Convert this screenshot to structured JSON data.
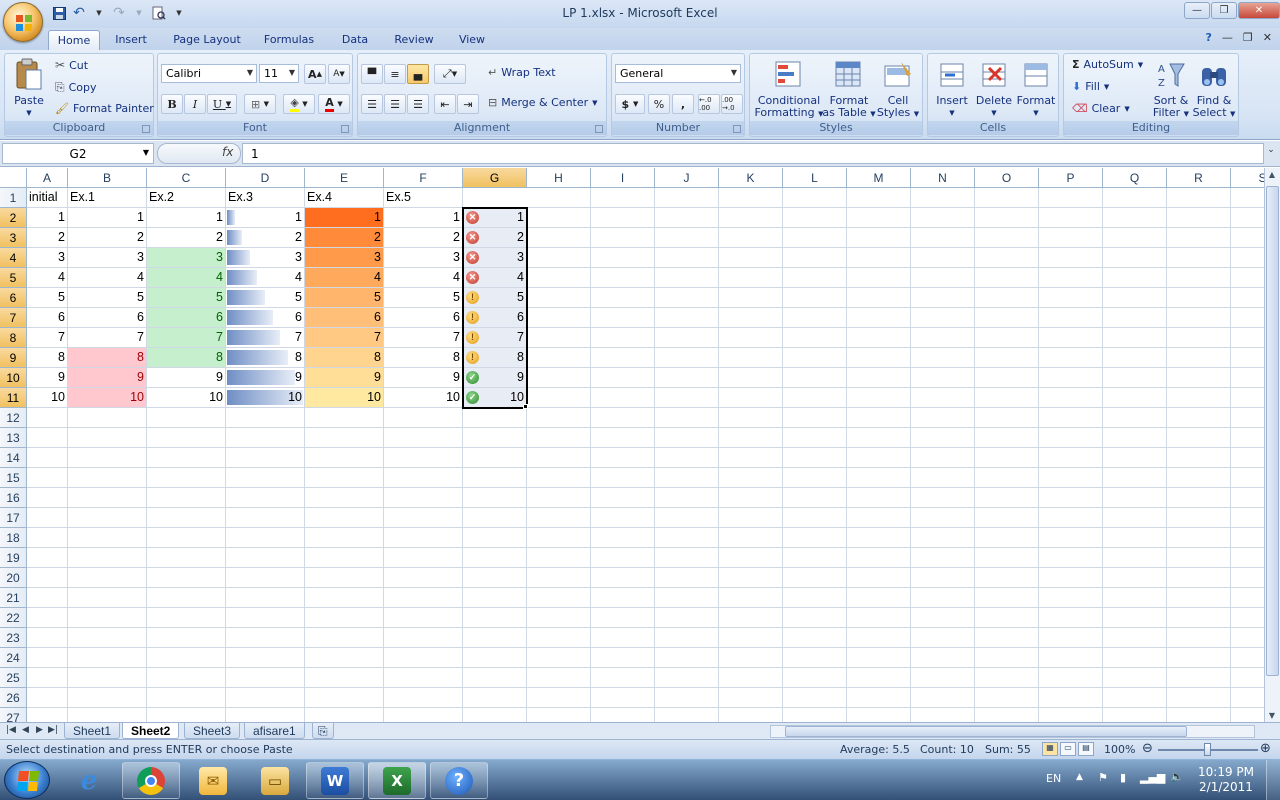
{
  "window": {
    "title": "LP 1.xlsx - Microsoft Excel"
  },
  "quick_access": {
    "icons": [
      "save-icon",
      "undo-icon",
      "redo-icon",
      "print-preview-icon",
      "customize-icon"
    ]
  },
  "ribbon_tabs": [
    "Home",
    "Insert",
    "Page Layout",
    "Formulas",
    "Data",
    "Review",
    "View"
  ],
  "active_tab": "Home",
  "clipboard": {
    "paste": "Paste",
    "cut": "Cut",
    "copy": "Copy",
    "format_painter": "Format Painter",
    "label": "Clipboard"
  },
  "font": {
    "family": "Calibri",
    "size": "11",
    "label": "Font",
    "bold": "B",
    "italic": "I",
    "underline": "U",
    "grow": "A",
    "shrink": "A",
    "color_letter": "A"
  },
  "alignment": {
    "wrap": "Wrap Text",
    "merge": "Merge & Center",
    "label": "Alignment"
  },
  "number": {
    "format": "General",
    "currency": "$",
    "percent": "%",
    "comma": ",",
    "inc_decimal": "←.0 .00",
    "dec_decimal": ".00 →.0",
    "label": "Number"
  },
  "styles": {
    "conditional_1": "Conditional",
    "conditional_2": "Formatting",
    "format_table_1": "Format",
    "format_table_2": "as Table",
    "cell_styles_1": "Cell",
    "cell_styles_2": "Styles",
    "label": "Styles"
  },
  "cells_group": {
    "insert": "Insert",
    "delete": "Delete",
    "format": "Format",
    "label": "Cells"
  },
  "editing": {
    "autosum": "AutoSum",
    "fill": "Fill",
    "clear": "Clear",
    "sort_1": "Sort &",
    "sort_2": "Filter",
    "find_1": "Find &",
    "find_2": "Select",
    "label": "Editing"
  },
  "formula_bar": {
    "name_box": "G2",
    "fx": "fx",
    "content": "1"
  },
  "columns": [
    "A",
    "B",
    "C",
    "D",
    "E",
    "F",
    "G",
    "H",
    "I",
    "J",
    "K",
    "L",
    "M",
    "N",
    "O",
    "P",
    "Q",
    "R",
    "S"
  ],
  "selected_column": "G",
  "row_numbers": [
    "1",
    "2",
    "3",
    "4",
    "5",
    "6",
    "7",
    "8",
    "9",
    "10",
    "11",
    "12",
    "13",
    "14",
    "15",
    "16",
    "17",
    "18",
    "19",
    "20",
    "21",
    "22",
    "23",
    "24",
    "25",
    "26",
    "27"
  ],
  "headers": {
    "A": "initial",
    "B": "Ex.1",
    "C": "Ex.2",
    "D": "Ex.3",
    "E": "Ex.4",
    "F": "Ex.5"
  },
  "values": [
    "1",
    "2",
    "3",
    "4",
    "5",
    "6",
    "7",
    "8",
    "9",
    "10"
  ],
  "conditional_formats": {
    "B_red_threshold": 8,
    "C_green_range": [
      3,
      8
    ],
    "D_databar_color": "#6f8ec4",
    "E_scale_colors": [
      "#ff6e1f",
      "#ff8a3a",
      "#ff9a4a",
      "#ffa95c",
      "#ffb56b",
      "#ffbf78",
      "#ffc883",
      "#ffd48e",
      "#ffde97",
      "#ffe9a0"
    ],
    "G_icons": [
      "x",
      "x",
      "x",
      "x",
      "warn",
      "warn",
      "warn",
      "warn",
      "ok",
      "ok"
    ]
  },
  "sheet_tabs": [
    "Sheet1",
    "Sheet2",
    "Sheet3",
    "afisare1"
  ],
  "active_sheet": "Sheet2",
  "status": {
    "message": "Select destination and press ENTER or choose Paste",
    "average": "Average: 5.5",
    "count": "Count: 10",
    "sum": "Sum: 55",
    "zoom": "100%"
  },
  "taskbar": {
    "apps": [
      "ie-icon",
      "chrome-icon",
      "outlook-icon",
      "explorer-icon",
      "word-icon",
      "excel-icon",
      "help-icon"
    ],
    "language": "EN",
    "time": "10:19 PM",
    "date": "2/1/2011"
  }
}
